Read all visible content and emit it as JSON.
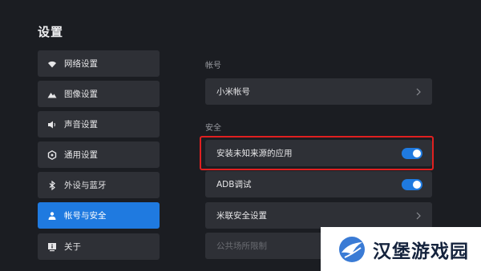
{
  "page": {
    "title": "设置"
  },
  "sidebar": {
    "items": [
      {
        "label": "网络设置",
        "icon": "wifi-icon",
        "active": false
      },
      {
        "label": "图像设置",
        "icon": "mountain-image-icon",
        "active": false
      },
      {
        "label": "声音设置",
        "icon": "speaker-icon",
        "active": false
      },
      {
        "label": "通用设置",
        "icon": "gear-icon",
        "active": false
      },
      {
        "label": "外设与蓝牙",
        "icon": "bluetooth-icon",
        "active": false
      },
      {
        "label": "帐号与安全",
        "icon": "user-icon",
        "active": true
      },
      {
        "label": "关于",
        "icon": "info-icon",
        "active": false
      }
    ]
  },
  "account": {
    "section_label": "帐号",
    "items": [
      {
        "label": "小米帐号",
        "icon": "chevron-right-icon"
      }
    ]
  },
  "security": {
    "section_label": "安全",
    "items": [
      {
        "label": "安装未知来源的应用",
        "control": "toggle",
        "on": true,
        "highlighted": true
      },
      {
        "label": "ADB调试",
        "control": "toggle",
        "on": true
      },
      {
        "label": "米联安全设置",
        "control": "chevron-right-icon"
      },
      {
        "label": "公共场所限制",
        "control": "none",
        "dimmed": true
      }
    ]
  },
  "watermark": {
    "text": "汉堡游戏园"
  },
  "colors": {
    "accent": "#1f7ae0",
    "highlight": "#e02020",
    "background": "#1b1d22",
    "panel": "#2e3036"
  }
}
